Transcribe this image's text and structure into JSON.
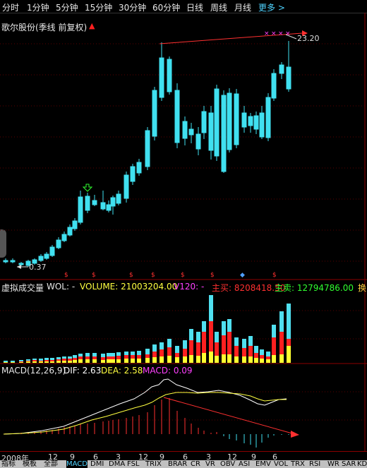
{
  "toolbar": {
    "periods": [
      "分时",
      "1分钟",
      "5分钟",
      "15分钟",
      "30分钟",
      "60分钟",
      "日线",
      "周线",
      "月线"
    ],
    "more": "更多 >"
  },
  "price_panel": {
    "title": "歌尔股份(季线 前复权)",
    "high_label": "23.20",
    "low_label": "0.37",
    "up_color": "#ff2020",
    "down_color": "#40e0f0"
  },
  "volume_panel": {
    "name": "虚拟成交量",
    "wol": "WOL: -",
    "volume": "VOLUME: 21003204.00",
    "v120": "V120: -",
    "buy": "主买: 8208418.50",
    "sell": "主卖: 12794786.00",
    "switch": "换"
  },
  "macd_panel": {
    "name": "MACD(12,26,9)",
    "dif": "DIF: 2.63",
    "dea": "DEA: 2.58",
    "macd": "MACD: 0.09"
  },
  "time_axis": [
    "2008年",
    "12",
    "9",
    "6",
    "3",
    "12",
    "9",
    "6",
    "3",
    "12",
    "9",
    "6"
  ],
  "bottom_tabs": [
    "指标",
    "模板",
    "全部",
    "MACD",
    "DMI",
    "DMA",
    "FSL",
    "TRIX",
    "BRAR",
    "CR",
    "VR",
    "OBV",
    "ASI",
    "EMV",
    "VOL",
    "TRX",
    "RSI",
    "WR",
    "SAR",
    "KDJ"
  ],
  "active_tab": "MACD"
}
